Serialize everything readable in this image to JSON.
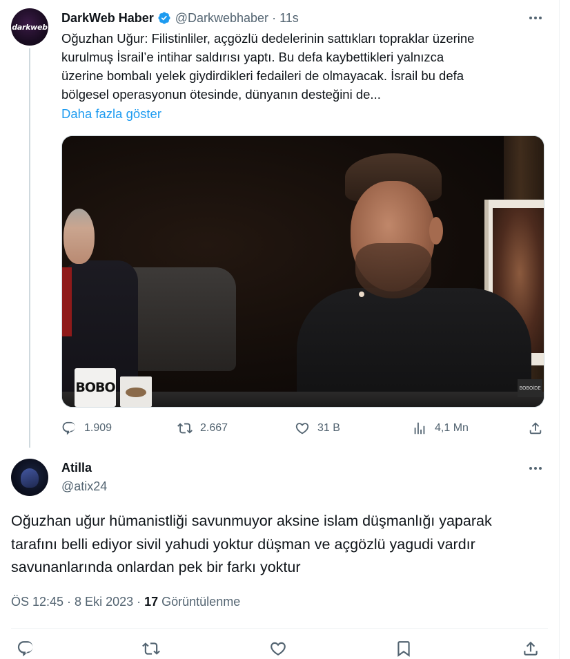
{
  "parent_tweet": {
    "author_name": "DarkWeb Haber",
    "avatar_text": "darkweb",
    "handle": "@Darkwebhaber",
    "separator": "·",
    "time": "11s",
    "text_lines": [
      "Oğuzhan Uğur: Filistinliler, açgözlü dedelerinin sattıkları topraklar üzerine",
      "kurulmuş İsrail’e intihar saldırısı yaptı. Bu defa kaybettikleri yalnızca",
      "üzerine bombalı yelek giydirdikleri fedaileri de olmayacak. İsrail bu defa",
      "bölgesel operasyonun ötesinde, dünyanın desteğini de..."
    ],
    "show_more": "Daha fazla göster",
    "media": {
      "cup_text": "BOBO",
      "watermark": "BOBOİDE"
    },
    "stats": {
      "replies": "1.909",
      "retweets": "2.667",
      "likes": "31 B",
      "views": "4,1 Mn"
    }
  },
  "reply_tweet": {
    "author_name": "Atilla",
    "handle": "@atix24",
    "text_lines": [
      "Oğuzhan uğur hümanistliği savunmuyor aksine islam düşmanlığı yaparak",
      "tarafını belli ediyor sivil yahudi yoktur düşman ve açgözlü yagudi vardır",
      "savunanlarında onlardan pek bir farkı yoktur"
    ],
    "timestamp": "ÖS 12:45 · 8 Eki 2023 · ",
    "view_count": "17",
    "view_label": " Görüntülenme"
  },
  "colors": {
    "accent": "#1d9bf0",
    "secondary_text": "#536471",
    "primary_text": "#0f1419",
    "verified_badge": "#1d9bf0"
  },
  "icons": [
    "verified-badge-icon",
    "more-icon",
    "reply-icon",
    "retweet-icon",
    "like-icon",
    "views-icon",
    "share-icon",
    "bookmark-icon"
  ]
}
